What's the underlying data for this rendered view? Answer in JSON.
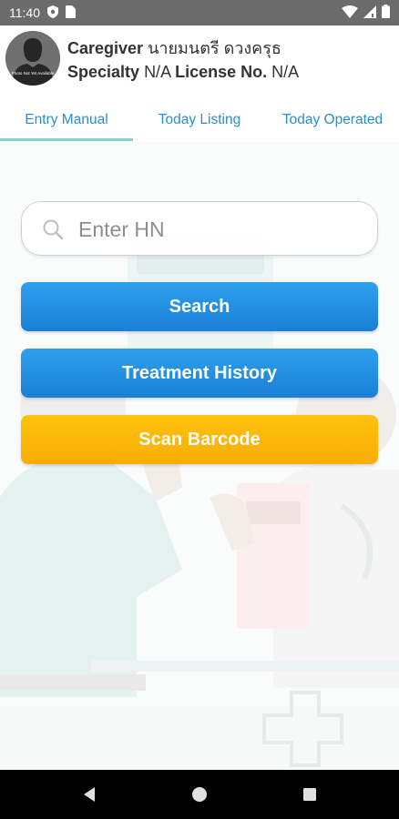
{
  "status_bar": {
    "time": "11:40",
    "left_icons": [
      "shield-icon",
      "sim-card-icon"
    ],
    "right_icons": [
      "wifi-icon",
      "signal-icon",
      "battery-icon"
    ]
  },
  "profile": {
    "avatar_caption": "Photo Not Yet Available",
    "caregiver_label": "Caregiver",
    "caregiver_name": "นายมนตรี ดวงครุธ",
    "specialty_label": "Specialty",
    "specialty_value": "N/A",
    "license_label": "License No.",
    "license_value": "N/A"
  },
  "tabs": [
    {
      "label": "Entry Manual",
      "active": true
    },
    {
      "label": "Today Listing",
      "active": false
    },
    {
      "label": "Today Operated",
      "active": false
    }
  ],
  "search": {
    "placeholder": "Enter HN",
    "value": ""
  },
  "buttons": {
    "search": "Search",
    "treatment_history": "Treatment History",
    "scan_barcode": "Scan Barcode"
  },
  "colors": {
    "accent_blue": "#2a8fcf",
    "button_blue": "#1e8ee0",
    "button_orange": "#fbb309",
    "tab_indicator": "#7fd3cb"
  },
  "nav_bar": {
    "icons": [
      "back-icon",
      "home-icon",
      "recent-apps-icon"
    ]
  }
}
